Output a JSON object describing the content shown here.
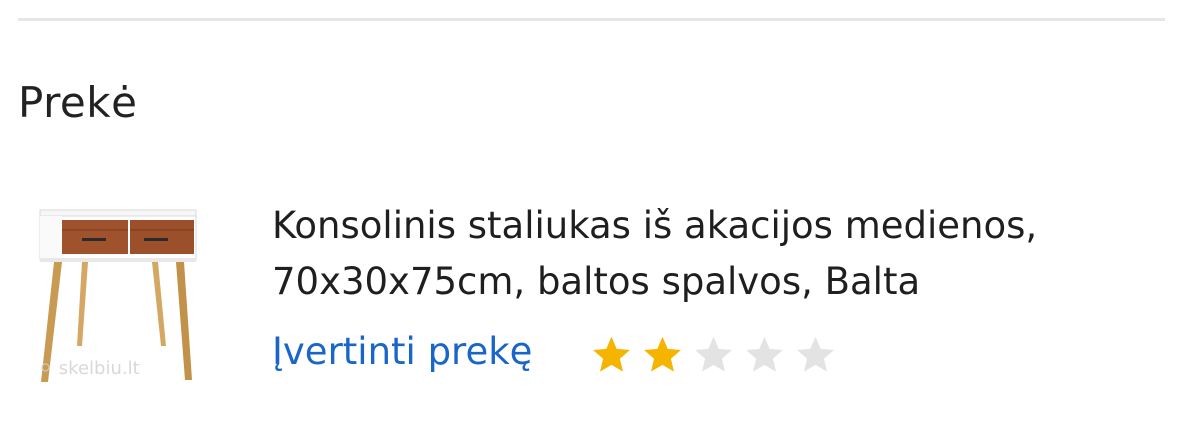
{
  "section": {
    "title": "Prekė"
  },
  "product": {
    "name_line1": "Konsolinis staliukas iš akacijos medienos,",
    "name_line2": "70x30x75cm, baltos spalvos, Balta",
    "image_icon": "console-table-image",
    "watermark": "skelbiu.lt"
  },
  "rating": {
    "link_label": "Įvertinti prekę",
    "value": 2,
    "max": 5,
    "filled_color": "#f5b400",
    "empty_color": "#e3e3e3"
  },
  "colors": {
    "link": "#1a66c8",
    "divider": "#e6e6e6",
    "text": "#222222"
  }
}
